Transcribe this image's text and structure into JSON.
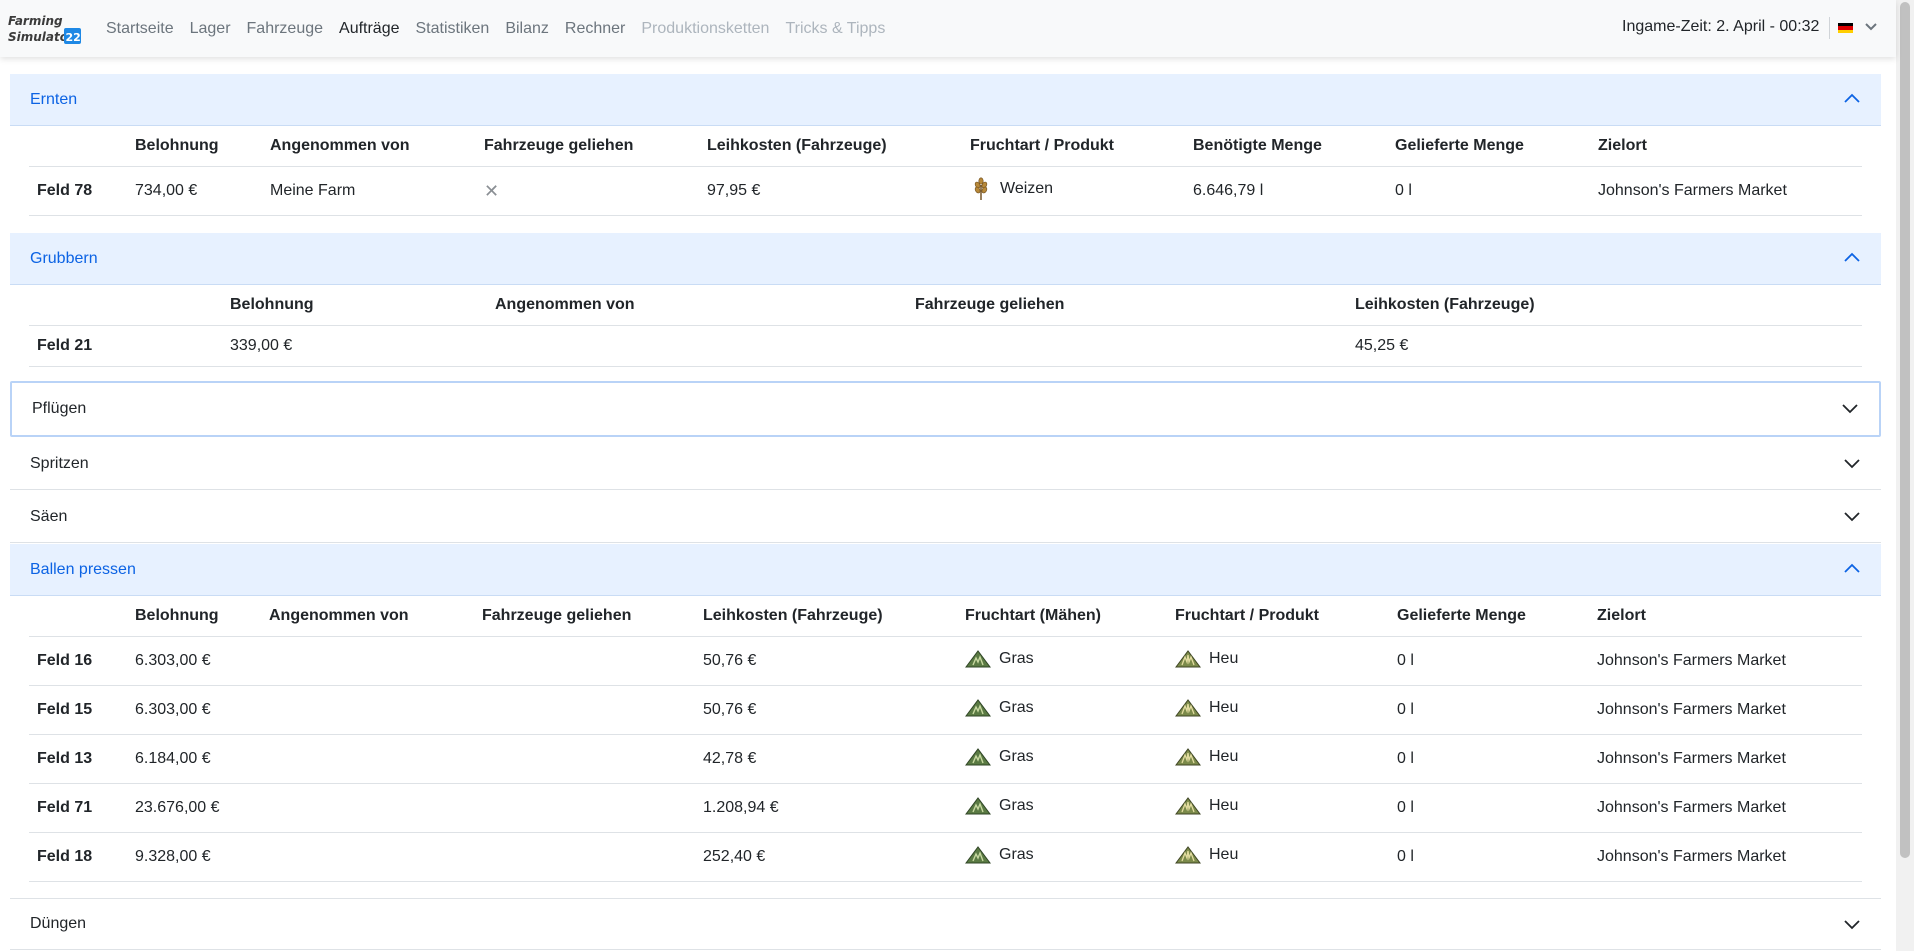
{
  "brand": {
    "logo_text_1": "Farming",
    "logo_text_2": "Simulator",
    "logo_num": "22"
  },
  "nav": {
    "items": [
      {
        "label": "Startseite",
        "state": "normal"
      },
      {
        "label": "Lager",
        "state": "normal"
      },
      {
        "label": "Fahrzeuge",
        "state": "normal"
      },
      {
        "label": "Aufträge",
        "state": "active"
      },
      {
        "label": "Statistiken",
        "state": "normal"
      },
      {
        "label": "Bilanz",
        "state": "normal"
      },
      {
        "label": "Rechner",
        "state": "normal"
      },
      {
        "label": "Produktionsketten",
        "state": "disabled"
      },
      {
        "label": "Tricks & Tipps",
        "state": "disabled"
      }
    ],
    "ingame_time": "Ingame-Zeit: 2. April - 00:32",
    "language_flag": "flag-de-icon"
  },
  "sections": {
    "ernten": {
      "title": "Ernten",
      "headers": [
        "",
        "Belohnung",
        "Angenommen von",
        "Fahrzeuge geliehen",
        "Leihkosten (Fahrzeuge)",
        "Fruchtart / Produkt",
        "Benötigte Menge",
        "Gelieferte Menge",
        "Zielort"
      ],
      "rows": [
        {
          "feld": "Feld 78",
          "belohnung": "734,00 €",
          "angenommen": "Meine Farm",
          "geliehen": "✕",
          "leihkosten": "97,95 €",
          "produkt": "Weizen",
          "produkt_icon": "wheat-icon",
          "benoetigt": "6.646,79 l",
          "geliefert": "0 l",
          "zielort": "Johnson's Farmers Market"
        }
      ]
    },
    "grubbern": {
      "title": "Grubbern",
      "headers": [
        "",
        "Belohnung",
        "Angenommen von",
        "Fahrzeuge geliehen",
        "Leihkosten (Fahrzeuge)"
      ],
      "rows": [
        {
          "feld": "Feld 21",
          "belohnung": "339,00 €",
          "angenommen": "",
          "geliehen": "",
          "leihkosten": "45,25 €"
        }
      ]
    },
    "pfluegen": {
      "title": "Pflügen"
    },
    "spritzen": {
      "title": "Spritzen"
    },
    "saeen": {
      "title": "Säen"
    },
    "ballen": {
      "title": "Ballen pressen",
      "headers": [
        "",
        "Belohnung",
        "Angenommen von",
        "Fahrzeuge geliehen",
        "Leihkosten (Fahrzeuge)",
        "Fruchtart (Mähen)",
        "Fruchtart / Produkt",
        "Gelieferte Menge",
        "Zielort"
      ],
      "rows": [
        {
          "feld": "Feld 16",
          "belohnung": "6.303,00 €",
          "angenommen": "",
          "geliehen": "",
          "leihkosten": "50,76 €",
          "maehen": "Gras",
          "produkt": "Heu",
          "geliefert": "0 l",
          "zielort": "Johnson's Farmers Market"
        },
        {
          "feld": "Feld 15",
          "belohnung": "6.303,00 €",
          "angenommen": "",
          "geliehen": "",
          "leihkosten": "50,76 €",
          "maehen": "Gras",
          "produkt": "Heu",
          "geliefert": "0 l",
          "zielort": "Johnson's Farmers Market"
        },
        {
          "feld": "Feld 13",
          "belohnung": "6.184,00 €",
          "angenommen": "",
          "geliehen": "",
          "leihkosten": "42,78 €",
          "maehen": "Gras",
          "produkt": "Heu",
          "geliefert": "0 l",
          "zielort": "Johnson's Farmers Market"
        },
        {
          "feld": "Feld 71",
          "belohnung": "23.676,00 €",
          "angenommen": "",
          "geliehen": "",
          "leihkosten": "1.208,94 €",
          "maehen": "Gras",
          "produkt": "Heu",
          "geliefert": "0 l",
          "zielort": "Johnson's Farmers Market"
        },
        {
          "feld": "Feld 18",
          "belohnung": "9.328,00 €",
          "angenommen": "",
          "geliehen": "",
          "leihkosten": "252,40 €",
          "maehen": "Gras",
          "produkt": "Heu",
          "geliefert": "0 l",
          "zielort": "Johnson's Farmers Market"
        }
      ]
    },
    "duengen": {
      "title": "Düngen"
    }
  },
  "colors": {
    "accent": "#0c63e4",
    "open_header_bg": "#e7f1ff",
    "grass": "#5a7a43",
    "hay": "#7b8a4a",
    "wheat": "#b8893a"
  }
}
